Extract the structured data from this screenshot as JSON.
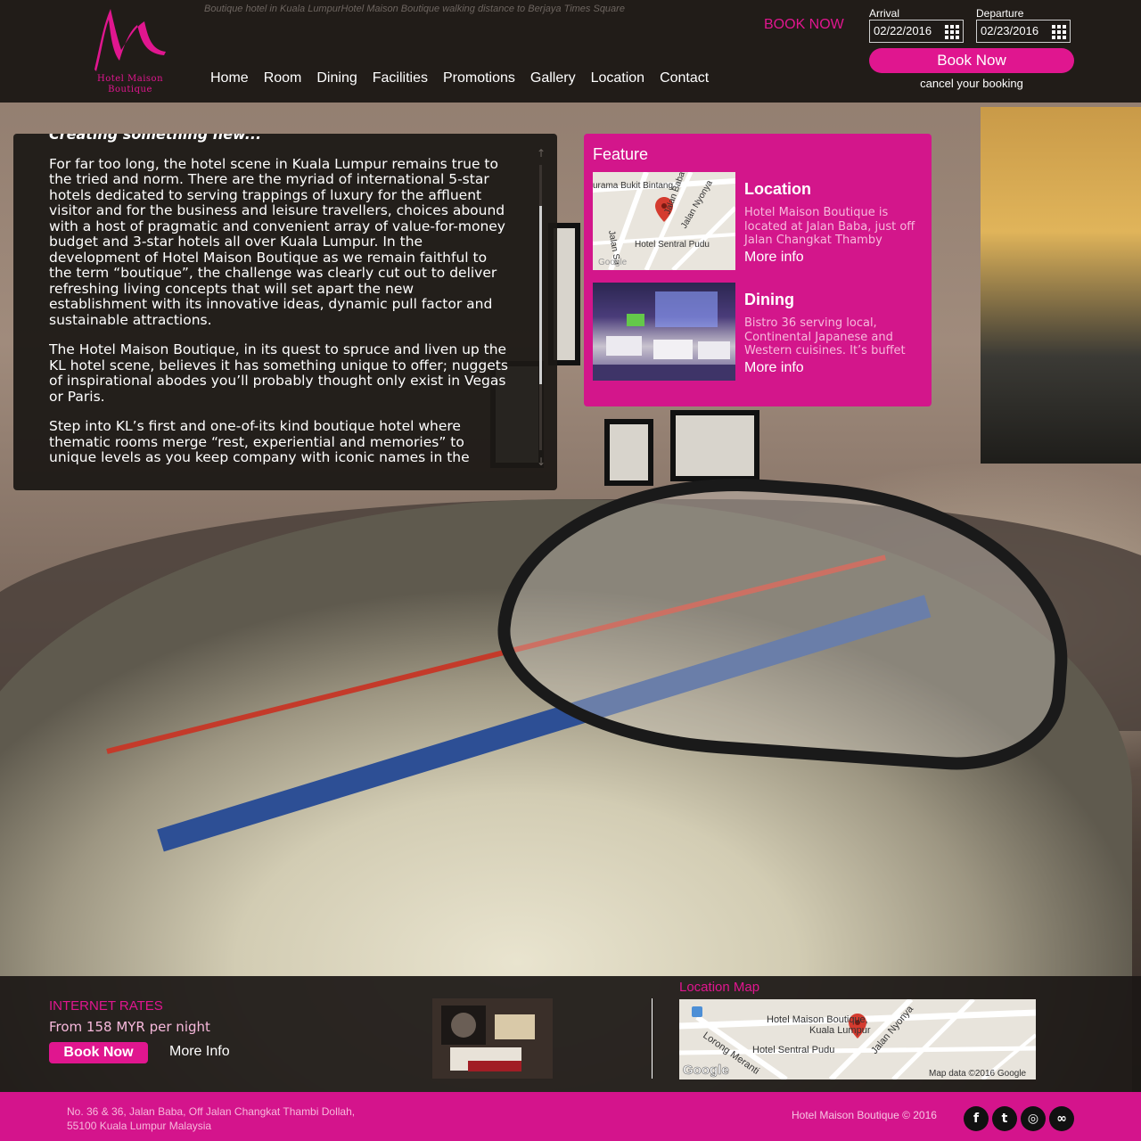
{
  "header": {
    "logo_letter": "M",
    "logo_line1": "Hotel Maison",
    "logo_line2": "Boutique",
    "tagline": "Boutique hotel in Kuala LumpurHotel Maison Boutique walking distance to Berjaya Times Square",
    "nav": [
      "Home",
      "Room",
      "Dining",
      "Facilities",
      "Promotions",
      "Gallery",
      "Location",
      "Contact"
    ],
    "book_now_label": "BOOK NOW",
    "arrival_label": "Arrival",
    "arrival_value": "02/22/2016",
    "departure_label": "Departure",
    "departure_value": "02/23/2016",
    "book_button": "Book Now",
    "cancel_link": "cancel your booking"
  },
  "article": {
    "heading_partial": "Creating something new...",
    "paragraphs": [
      "For far too long, the hotel scene in Kuala Lumpur remains true to the tried and norm. There are the myriad of international 5-star hotels dedicated to serving trappings of luxury for the affluent visitor and for the business and leisure travellers, choices abound with a host of pragmatic and convenient array of value-for-money budget and 3-star hotels all over Kuala Lumpur. In the development of Hotel Maison Boutique as we remain faithful to the term “boutique”, the challenge was clearly cut out to deliver refreshing living concepts that will set apart the new establishment with its innovative ideas, dynamic pull factor and sustainable attractions.",
      "The Hotel Maison Boutique, in its quest to spruce and liven up the KL hotel scene, believes it has something unique to offer; nuggets of inspirational abodes you’ll probably thought only exist in Vegas or Paris.",
      "Step into KL’s first and one-of-its kind boutique hotel where thematic rooms merge “rest, experiential and memories” to unique levels as you keep company with iconic names in the"
    ],
    "scroll_up": "↑",
    "scroll_down": "↓"
  },
  "feature": {
    "title": "Feature",
    "items": [
      {
        "heading": "Location",
        "desc": "Hotel Maison Boutique is located at Jalan Baba, just off Jalan Changkat Thamby",
        "more": "More info",
        "map_labels": [
          "urama Bukit Bintang",
          "Jalan Baba",
          "Jalan Nyonya",
          "Hotel Sentral Pudu",
          "Jalan Sa",
          "Google"
        ]
      },
      {
        "heading": "Dining",
        "desc": "Bistro 36 serving local, Continental Japanese and Western cuisines. It’s buffet",
        "more": "More info"
      }
    ]
  },
  "bottom": {
    "rates_title": "INTERNET RATES",
    "rates_price": "From 158 MYR per night",
    "rates_book": "Book Now",
    "rates_more": "More Info",
    "map_title": "Location Map",
    "map_labels": [
      "Hotel Maison Boutique,",
      "Kuala Lumpur",
      "Hotel Sentral Pudu",
      "Lorong Meranti",
      "Jalan Nyonya",
      "Google",
      "Map data ©2016 Google"
    ]
  },
  "footer": {
    "address_line1": "No. 36 & 36, Jalan Baba, Off Jalan Changkat Thambi Dollah,",
    "address_line2": "55100 Kuala Lumpur Malaysia",
    "copyright": "Hotel Maison Boutique © 2016",
    "social": [
      {
        "name": "facebook-icon",
        "glyph": "f"
      },
      {
        "name": "twitter-icon",
        "glyph": "t"
      },
      {
        "name": "instagram-icon",
        "glyph": "◎"
      },
      {
        "name": "tripadvisor-icon",
        "glyph": "∞"
      }
    ]
  },
  "colors": {
    "brand_pink": "#e0168f",
    "panel_dark": "#1c1815",
    "footer_pink": "#d4148c"
  }
}
